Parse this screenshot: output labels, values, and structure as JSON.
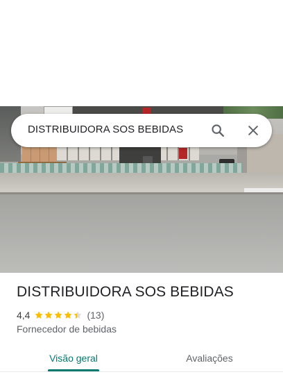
{
  "search": {
    "query": "DISTRIBUIDORA SOS BEBIDAS",
    "search_icon": "search-icon",
    "clear_icon": "close-icon"
  },
  "place": {
    "name": "DISTRIBUIDORA SOS BEBIDAS",
    "rating": "4,4",
    "stars_value": 4.4,
    "review_count": "(13)",
    "category": "Fornecedor de bebidas",
    "photo": "street-view-photo"
  },
  "tabs": [
    {
      "label": "Visão geral",
      "selected": true
    },
    {
      "label": "Avaliações",
      "selected": false
    }
  ],
  "colors": {
    "accent": "#01796f",
    "star": "#fbbc04",
    "star_empty": "#dadce0",
    "text_primary": "#202124",
    "text_secondary": "#5f6368"
  }
}
